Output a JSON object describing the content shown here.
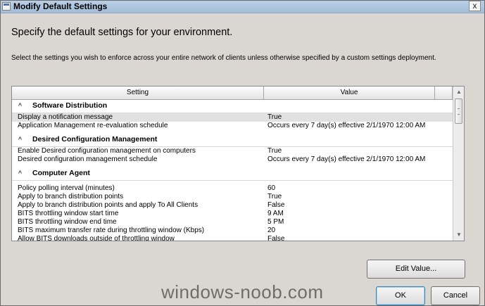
{
  "window": {
    "title": "Modify Default Settings",
    "close_glyph": "x"
  },
  "heading": "Specify the default settings for your environment.",
  "instruction": "Select the settings you wish to enforce across your entire network of clients unless otherwise specified by a custom settings deployment.",
  "grid": {
    "columns": [
      "Setting",
      "Value",
      ""
    ],
    "groups": [
      {
        "title": "Software Distribution",
        "toggle": "^",
        "rows": [
          {
            "setting": "Display a notification message",
            "value": "True",
            "selected": true
          },
          {
            "setting": "Application Management re-evaluation schedule",
            "value": "Occurs every 7 day(s) effective 2/1/1970 12:00 AM"
          }
        ]
      },
      {
        "title": "Desired Configuration Management",
        "toggle": "^",
        "rows": [
          {
            "setting": "Enable Desired configuration management on computers",
            "value": "True"
          },
          {
            "setting": "Desired configuration management schedule",
            "value": "Occurs every 7 day(s) effective 2/1/1970 12:00 AM"
          }
        ]
      },
      {
        "title": "Computer Agent",
        "toggle": "^",
        "rows": [
          {
            "setting": "Policy polling interval (minutes)",
            "value": "60"
          },
          {
            "setting": "Apply to branch distribution points",
            "value": "True"
          },
          {
            "setting": "Apply to branch distribution points and apply To All Clients",
            "value": "False"
          },
          {
            "setting": "BITS throttling window start time",
            "value": "9 AM"
          },
          {
            "setting": "BITS throttling window end time",
            "value": "5 PM"
          },
          {
            "setting": "BITS maximum transfer rate during throttling window (Kbps)",
            "value": "20"
          },
          {
            "setting": "Allow BITS downloads outside of throttling window",
            "value": "False"
          }
        ]
      }
    ],
    "scroll_up_glyph": "▲",
    "scroll_down_glyph": "▼"
  },
  "buttons": {
    "edit_value": "Edit Value...",
    "ok": "OK",
    "cancel": "Cancel"
  },
  "watermark": "windows-noob.com"
}
